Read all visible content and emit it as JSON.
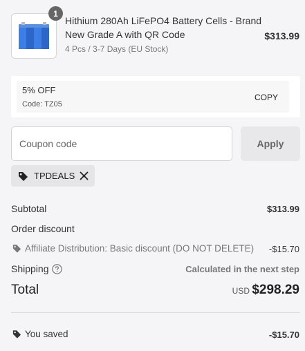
{
  "product": {
    "quantity": "1",
    "title": "Hithium 280Ah LiFePO4 Battery Cells - Brand New Grade A with QR Code",
    "variant": "4 Pcs / 3-7 Days (EU Stock)",
    "price": "$313.99",
    "image_icon": "battery-pack-image"
  },
  "discount_card": {
    "title": "5% OFF",
    "code": "Code: TZ05",
    "copy_label": "COPY"
  },
  "coupon": {
    "placeholder": "Coupon code",
    "value": "",
    "apply_label": "Apply"
  },
  "applied_tag": {
    "label": "TPDEALS",
    "tag_icon": "tag-icon",
    "remove_icon": "close-icon"
  },
  "summary": {
    "subtotal_label": "Subtotal",
    "subtotal_value": "$313.99",
    "order_discount_label": "Order discount",
    "affiliate_label": "Affiliate Distribution: Basic discount (DO NOT DELETE)",
    "affiliate_value": "-$15.70",
    "shipping_label": "Shipping",
    "shipping_value": "Calculated in the next step",
    "total_label": "Total",
    "currency": "USD",
    "total_value": "$298.29",
    "saved_label": "You saved",
    "saved_value": "-$15.70"
  },
  "colors": {
    "background": "#f5f5f7",
    "battery_blue": "#2f6fd6",
    "muted_text": "#777777"
  }
}
